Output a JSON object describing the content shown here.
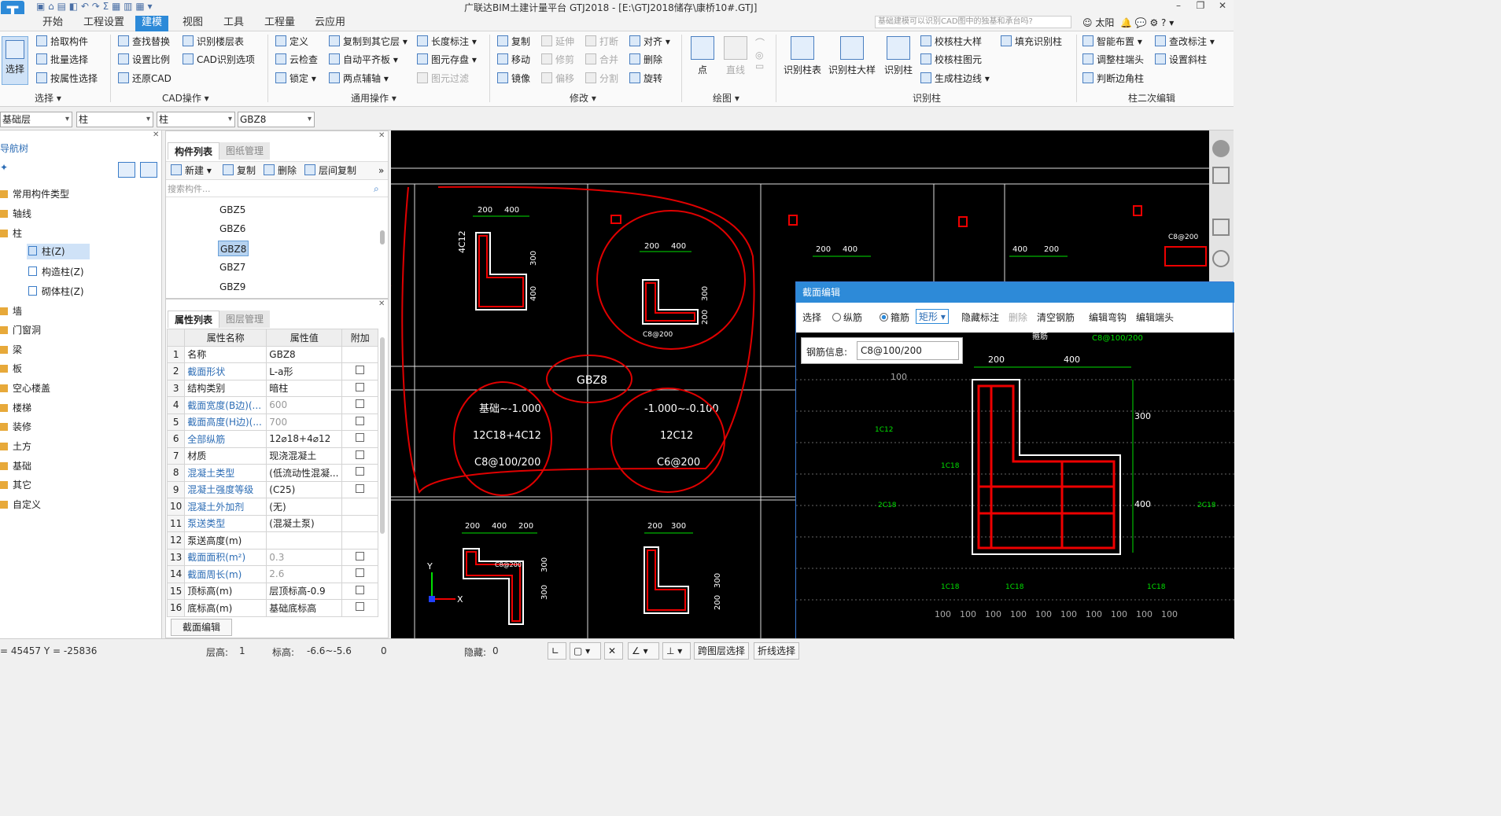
{
  "window": {
    "title": "广联达BIM土建计量平台 GTJ2018 - [E:\\GTJ2018储存\\康桥10#.GTJ]",
    "controls": [
      "–",
      "❐",
      "✕"
    ]
  },
  "menu": {
    "tabs": [
      "开始",
      "工程设置",
      "建模",
      "视图",
      "工具",
      "工程量",
      "云应用"
    ],
    "active": "建模",
    "search_placeholder": "基础建模可以识别CAD图中的独基和承台吗?",
    "user": "太阳"
  },
  "ribbon": {
    "select_big": "选择",
    "select_items": [
      "拾取构件",
      "批量选择",
      "按属性选择"
    ],
    "cad_items": [
      "查找替换",
      "设置比例",
      "还原CAD",
      "识别楼层表",
      "CAD识别选项"
    ],
    "general_items": [
      "定义",
      "云检查",
      "锁定 ▾",
      "复制到其它层 ▾",
      "自动平齐板 ▾",
      "两点辅轴 ▾",
      "长度标注 ▾",
      "图元存盘 ▾",
      "图元过滤"
    ],
    "modify_items": [
      "复制",
      "移动",
      "镜像",
      "延伸",
      "修剪",
      "偏移",
      "打断",
      "合并",
      "分割",
      "对齐 ▾",
      "删除",
      "旋转"
    ],
    "draw_items": [
      "点",
      "直线"
    ],
    "recog_big": [
      "识别柱表",
      "识别柱大样",
      "识别柱"
    ],
    "recog_items": [
      "校核柱大样",
      "校核柱图元",
      "生成柱边线 ▾",
      "填充识别柱"
    ],
    "col2_items": [
      "智能布置 ▾",
      "调整柱端头",
      "判断边角柱",
      "查改标注 ▾",
      "设置斜柱"
    ],
    "groups": [
      "选择 ▾",
      "CAD操作 ▾",
      "通用操作 ▾",
      "修改 ▾",
      "绘图 ▾",
      "识别柱",
      "柱二次编辑"
    ]
  },
  "dropdowns": [
    "基础层",
    "柱",
    "柱",
    "GBZ8"
  ],
  "nav": {
    "title": "导航树",
    "items": [
      "常用构件类型",
      "轴线",
      "柱",
      "柱(Z)",
      "构造柱(Z)",
      "砌体柱(Z)",
      "墙",
      "门窗洞",
      "梁",
      "板",
      "空心楼盖",
      "楼梯",
      "装修",
      "土方",
      "基础",
      "其它",
      "自定义"
    ]
  },
  "component": {
    "tabs": [
      "构件列表",
      "图纸管理"
    ],
    "toolbar": [
      "新建 ▾",
      "复制",
      "删除",
      "层间复制"
    ],
    "search_placeholder": "搜索构件...",
    "items": [
      "GBZ5",
      "GBZ6",
      "GBZ8",
      "GBZ7",
      "GBZ9"
    ],
    "selected": "GBZ8"
  },
  "properties": {
    "tabs": [
      "属性列表",
      "图层管理"
    ],
    "headers": [
      "属性名称",
      "属性值",
      "附加"
    ],
    "rows": [
      {
        "n": "1",
        "name": "名称",
        "value": "GBZ8",
        "cb": false
      },
      {
        "n": "2",
        "name": "截面形状",
        "value": "L-a形",
        "cb": true
      },
      {
        "n": "3",
        "name": "结构类别",
        "value": "暗柱",
        "cb": true
      },
      {
        "n": "4",
        "name": "截面宽度(B边)(...",
        "value": "600",
        "cb": true
      },
      {
        "n": "5",
        "name": "截面高度(H边)(...",
        "value": "700",
        "cb": true
      },
      {
        "n": "6",
        "name": "全部纵筋",
        "value": "12⌀18+4⌀12",
        "cb": true
      },
      {
        "n": "7",
        "name": "材质",
        "value": "现浇混凝土",
        "cb": true
      },
      {
        "n": "8",
        "name": "混凝土类型",
        "value": "(低流动性混凝...",
        "cb": true
      },
      {
        "n": "9",
        "name": "混凝土强度等级",
        "value": "(C25)",
        "cb": true
      },
      {
        "n": "10",
        "name": "混凝土外加剂",
        "value": "(无)",
        "cb": false
      },
      {
        "n": "11",
        "name": "泵送类型",
        "value": "(混凝土泵)",
        "cb": false
      },
      {
        "n": "12",
        "name": "泵送高度(m)",
        "value": "",
        "cb": false
      },
      {
        "n": "13",
        "name": "截面面积(m²)",
        "value": "0.3",
        "cb": true
      },
      {
        "n": "14",
        "name": "截面周长(m)",
        "value": "2.6",
        "cb": true
      },
      {
        "n": "15",
        "name": "顶标高(m)",
        "value": "层顶标高-0.9",
        "cb": true
      },
      {
        "n": "16",
        "name": "底标高(m)",
        "value": "基础底标高",
        "cb": true
      }
    ],
    "edit_button": "截面编辑"
  },
  "drawing": {
    "dims_a": [
      "200",
      "400"
    ],
    "dims_b": [
      "200",
      "400"
    ],
    "dims_c": [
      "200",
      "400"
    ],
    "dims_d": [
      "400",
      "200"
    ],
    "dims_e": [
      "200",
      "400",
      "200"
    ],
    "dims_f": [
      "200",
      "300"
    ],
    "side_a": [
      "300",
      "400"
    ],
    "side_b": [
      "300",
      "200"
    ],
    "side_e": [
      "300",
      "300"
    ],
    "side_f": [
      "300",
      "200"
    ],
    "label_4c12": "4C12",
    "label_c8200": "C8@200",
    "label_gbz8": "GBZ8",
    "elev1": "基础~-1.000",
    "rebar1": "12C18+4C12",
    "stir1": "C8@100/200",
    "elev2": "-1.000~-0.100",
    "rebar2": "12C12",
    "stir2": "C6@200",
    "axis_x": "X",
    "axis_y": "Y"
  },
  "section_editor": {
    "title": "截面编辑",
    "toolbar": [
      "选择",
      "纵筋",
      "箍筋",
      "矩形",
      "隐藏标注",
      "删除",
      "清空钢筋",
      "编辑弯钩",
      "编辑端头"
    ],
    "rebar_info_label": "钢筋信息:",
    "rebar_info_value": "C8@100/200",
    "labels": {
      "top": "箍筋",
      "top_spec": "C8@100/200",
      "dim200": "200",
      "dim400": "400",
      "dim300": "300",
      "dim400b": "400",
      "c12": "1C12",
      "c18": "1C18",
      "c18b": "2C18",
      "grid": "100"
    }
  },
  "status": {
    "coords": "= 45457 Y = -25836",
    "floor_height_label": "层高:",
    "floor_height": "1",
    "elev_label": "标高:",
    "elev": "-6.6~-5.6",
    "count": "0",
    "hidden_label": "隐藏:",
    "hidden": "0",
    "buttons": [
      "跨图层选择",
      "折线选择"
    ]
  }
}
